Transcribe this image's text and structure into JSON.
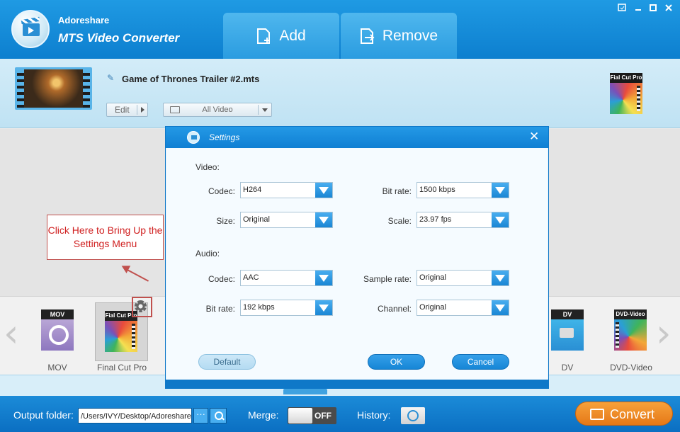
{
  "app": {
    "brand": "Adoreshare",
    "product": "MTS Video Converter",
    "add_label": "Add",
    "remove_label": "Remove"
  },
  "file": {
    "name": "Game of Thrones Trailer #2.mts",
    "edit_label": "Edit",
    "video_select": "All Video",
    "output_format_label": "Fial Cut Pro"
  },
  "callout": {
    "text": "Click Here to Bring Up the Settings Menu",
    "color": "#d02020"
  },
  "formats": [
    {
      "badge": "MOV",
      "label": "MOV"
    },
    {
      "badge": "Fial Cut Pro",
      "label": "Final Cut Pro",
      "selected": true
    },
    {
      "badge": "DV",
      "label": "DV"
    },
    {
      "badge": "DVD-Video",
      "label": "DVD-Video"
    }
  ],
  "settings": {
    "title": "Settings",
    "video_section": "Video:",
    "audio_section": "Audio:",
    "video": {
      "codec_label": "Codec:",
      "codec_value": "H264",
      "bitrate_label": "Bit rate:",
      "bitrate_value": "1500 kbps",
      "size_label": "Size:",
      "size_value": "Original",
      "scale_label": "Scale:",
      "scale_value": "23.97 fps"
    },
    "audio": {
      "codec_label": "Codec:",
      "codec_value": "AAC",
      "samplerate_label": "Sample rate:",
      "samplerate_value": "Original",
      "bitrate_label": "Bit rate:",
      "bitrate_value": "192 kbps",
      "channel_label": "Channel:",
      "channel_value": "Original"
    },
    "default_label": "Default",
    "ok_label": "OK",
    "cancel_label": "Cancel"
  },
  "bottom": {
    "output_label": "Output folder:",
    "output_path": "/Users/IVY/Desktop/Adoreshare",
    "browse_label": "···",
    "merge_label": "Merge:",
    "merge_state": "OFF",
    "history_label": "History:",
    "convert_label": "Convert"
  },
  "colors": {
    "accent": "#1686d6",
    "convert": "#f08b27",
    "callout_border": "#c0504d"
  }
}
